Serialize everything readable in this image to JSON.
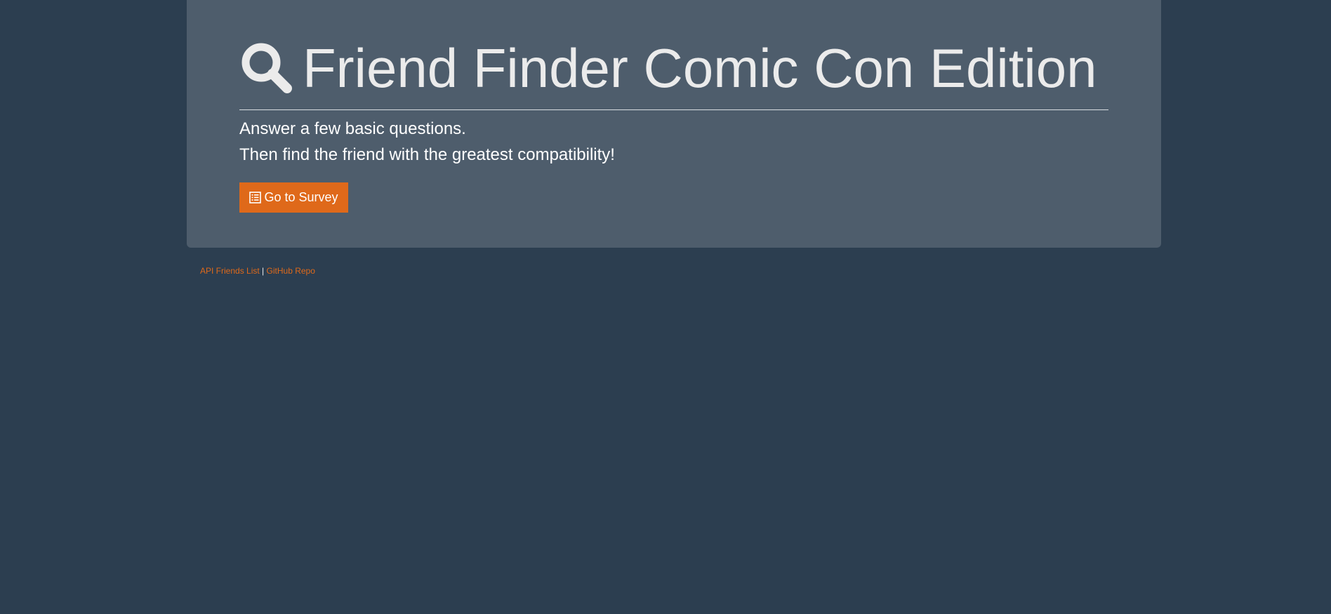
{
  "header": {
    "icon": "search-icon",
    "title": "Friend Finder Comic Con Edition",
    "lead_line_1": "Answer a few basic questions.",
    "lead_line_2": "Then find the friend with the greatest compatibility!"
  },
  "survey_button": {
    "icon": "list-alt-icon",
    "label": "Go to Survey"
  },
  "footer": {
    "api_link": "API Friends List",
    "separator": "|",
    "github_link": "GitHub Repo"
  },
  "colors": {
    "background": "#2c3e50",
    "panel": "#4e5d6c",
    "accent": "#df691a",
    "text": "#ebebeb"
  }
}
